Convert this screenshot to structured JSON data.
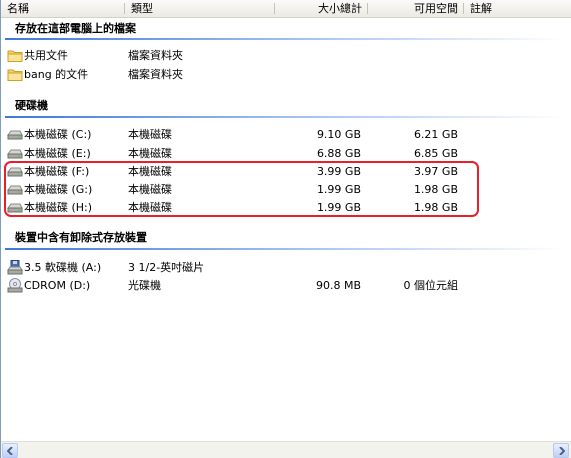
{
  "columns": {
    "name": "名稱",
    "type": "類型",
    "total": "大小總計",
    "free": "可用空間",
    "comment": "註解"
  },
  "groups": [
    {
      "title": "存放在這部電腦上的檔案",
      "items": [
        {
          "icon": "folder-icon",
          "name": "共用文件",
          "type": "檔案資料夾",
          "total": "",
          "free": ""
        },
        {
          "icon": "folder-icon",
          "name": "bang 的文件",
          "type": "檔案資料夾",
          "total": "",
          "free": ""
        }
      ]
    },
    {
      "title": "硬碟機",
      "items": [
        {
          "icon": "hard-drive-icon",
          "name": "本機磁碟 (C:)",
          "type": "本機磁碟",
          "total": "9.10 GB",
          "free": "6.21 GB"
        },
        {
          "icon": "hard-drive-icon",
          "name": "本機磁碟 (E:)",
          "type": "本機磁碟",
          "total": "6.88 GB",
          "free": "6.85 GB"
        },
        {
          "icon": "hard-drive-icon",
          "name": "本機磁碟 (F:)",
          "type": "本機磁碟",
          "total": "3.99 GB",
          "free": "3.97 GB"
        },
        {
          "icon": "hard-drive-icon",
          "name": "本機磁碟 (G:)",
          "type": "本機磁碟",
          "total": "1.99 GB",
          "free": "1.98 GB"
        },
        {
          "icon": "hard-drive-icon",
          "name": "本機磁碟 (H:)",
          "type": "本機磁碟",
          "total": "1.99 GB",
          "free": "1.98 GB"
        }
      ]
    },
    {
      "title": "裝置中含有卸除式存放裝置",
      "items": [
        {
          "icon": "floppy-drive-icon",
          "name": "3.5 軟碟機 (A:)",
          "type": "3 1/2-英吋磁片",
          "total": "",
          "free": ""
        },
        {
          "icon": "cdrom-drive-icon",
          "name": "CDROM (D:)",
          "type": "光碟機",
          "total": "90.8 MB",
          "free": "0 個位元組"
        }
      ]
    }
  ],
  "colors": {
    "highlight_border": "#e8202a",
    "group_line": "#3f78d8"
  }
}
